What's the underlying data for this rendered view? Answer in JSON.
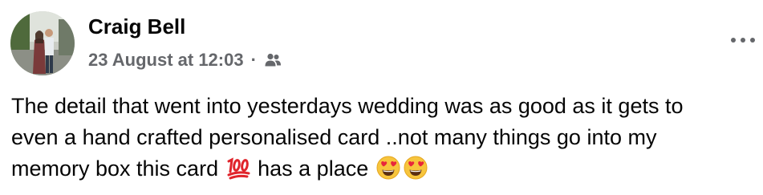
{
  "post": {
    "author_name": "Craig Bell",
    "timestamp": "23 August at 12:03",
    "separator": "·",
    "audience_icon": "friends-icon",
    "more_icon": "more-options-icon",
    "text_lines": [
      "The detail that went into yesterdays wedding was as good as it gets to",
      "even a hand crafted personalised card ..not many things go into my",
      "memory box this card"
    ],
    "text_line3_middle": "has a place",
    "emojis": [
      "hundred-points-emoji",
      "heart-eyes-emoji",
      "heart-eyes-emoji"
    ]
  }
}
